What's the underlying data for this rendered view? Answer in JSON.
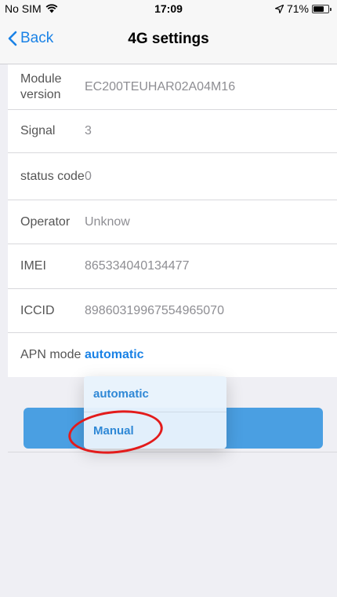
{
  "status_bar": {
    "carrier": "No SIM",
    "time": "17:09",
    "battery": "71%",
    "battery_level": 0.71
  },
  "nav": {
    "back_label": "Back",
    "title": "4G settings"
  },
  "rows": [
    {
      "label": "Module version",
      "value": "EC200TEUHAR02A04M16"
    },
    {
      "label": "Signal",
      "value": "3"
    },
    {
      "label": "status code",
      "value": "0"
    },
    {
      "label": "Operator",
      "value": "Unknow"
    },
    {
      "label": "IMEI",
      "value": "865334040134477"
    },
    {
      "label": "ICCID",
      "value": "89860319967554965070"
    },
    {
      "label": "APN mode",
      "value": "automatic"
    }
  ],
  "dropdown": {
    "options": [
      "automatic",
      "Manual"
    ],
    "highlighted": "Manual"
  },
  "colors": {
    "accent": "#1a82e6",
    "button": "#4a9fe2",
    "annotation": "#e31b1b"
  }
}
